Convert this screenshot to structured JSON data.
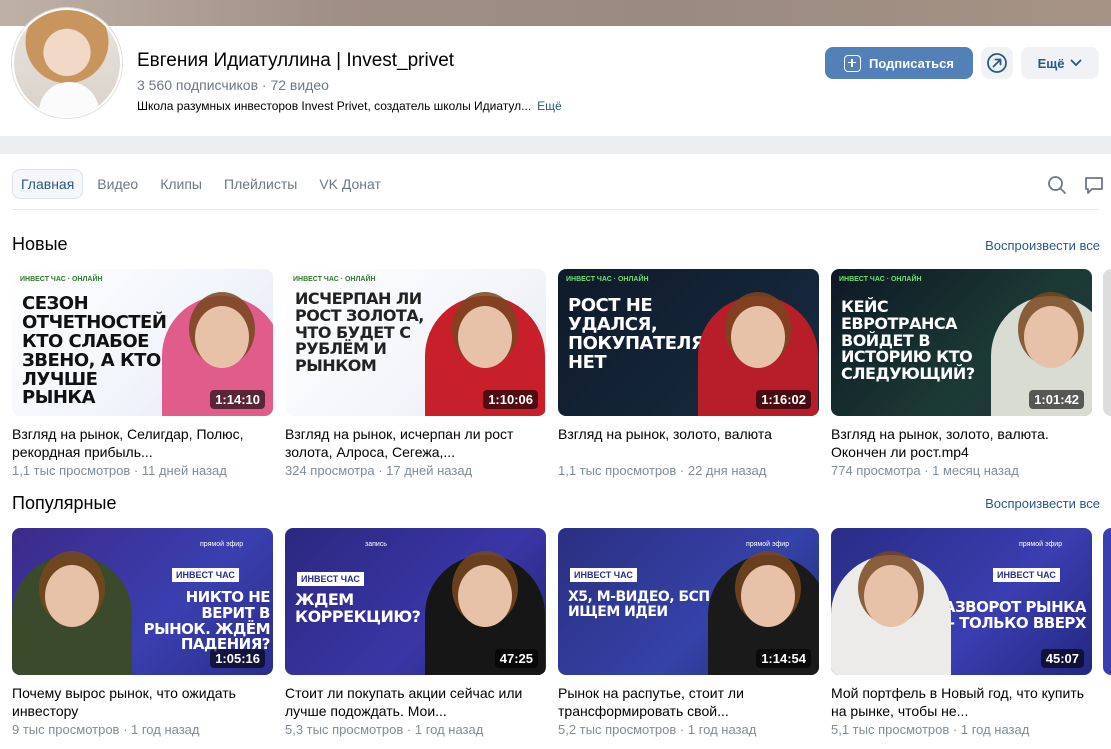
{
  "channel": {
    "name": "Евгения Идиатуллина | Invest_privet",
    "stats": "3 560 подписчиков · 72 видео",
    "description": "Школа разумных инвесторов Invest Privet, создатель школы Идиатул...",
    "description_more": "Ещё",
    "subscribe_label": "Подписаться",
    "more_label": "Ещё"
  },
  "tabs": [
    {
      "label": "Главная",
      "active": true
    },
    {
      "label": "Видео"
    },
    {
      "label": "Клипы"
    },
    {
      "label": "Плейлисты"
    },
    {
      "label": "VK Донат"
    }
  ],
  "sections": {
    "new": {
      "title": "Новые",
      "play_all": "Воспроизвести все"
    },
    "popular": {
      "title": "Популярные",
      "play_all": "Воспроизвести все"
    }
  },
  "new_videos": [
    {
      "title": "Взгляд на рынок, Селигдар, Полюс, рекордная прибыль...",
      "meta": "1,1 тыс просмотров · 11 дней назад",
      "duration": "1:14:10",
      "thumb_text": "СЕЗОН ОТЧЕТНОСТЕЙ КТО СЛАБОЕ ЗВЕНО, А КТО ЛУЧШЕ РЫНКА",
      "badge": "ИНВЕСТ ЧАС · ОНЛАЙН"
    },
    {
      "title": "Взгляд на рынок, исчерпан ли рост золота, Алроса, Сегежа,...",
      "meta": "324 просмотра · 17 дней назад",
      "duration": "1:10:06",
      "thumb_text": "ИСЧЕРПАН ЛИ РОСТ ЗОЛОТА, ЧТО БУДЕТ С РУБЛЁМ И РЫНКОМ",
      "badge": "ИНВЕСТ ЧАС · ОНЛАЙН"
    },
    {
      "title": "Взгляд на рынок, золото, валюта",
      "meta": "1,1 тыс просмотров · 22 дня назад",
      "duration": "1:16:02",
      "thumb_text": "РОСТ НЕ УДАЛСЯ, ПОКУПАТЕЛЯ НЕТ",
      "badge": "ИНВЕСТ ЧАС · ОНЛАЙН"
    },
    {
      "title": "Взгляд на рынок, золото, валюта. Окончен ли рост.mp4",
      "meta": "774 просмотра · 1 месяц назад",
      "duration": "1:01:42",
      "thumb_text": "КЕЙС ЕВРОТРАНСА ВОЙДЕТ В ИСТОРИЮ КТО СЛЕДУЮЩИЙ?",
      "badge": "ИНВЕСТ ЧАС · ОНЛАЙН"
    }
  ],
  "popular_videos": [
    {
      "title": "Почему вырос рынок, что ожидать инвестору",
      "meta": "9 тыс просмотров · 1 год назад",
      "duration": "1:05:16",
      "thumb_text": "НИКТО НЕ ВЕРИТ В РЫНОК. ЖДЁМ ПАДЕНИЯ?",
      "badge": "ИНВЕСТ ЧАС",
      "live": "прямой эфир"
    },
    {
      "title": "Стоит ли покупать акции сейчас или лучше подождать. Мои...",
      "meta": "5,3 тыс просмотров · 1 год назад",
      "duration": "47:25",
      "thumb_text": "ЖДЕМ КОРРЕКЦИЮ?",
      "badge": "ИНВЕСТ ЧАС",
      "live": "запись"
    },
    {
      "title": "Рынок на распутье, стоит ли трансформировать свой...",
      "meta": "5,2 тыс просмотров · 1 год назад",
      "duration": "1:14:54",
      "thumb_text": "X5, М-ВИДЕО, БСП - ИЩЕМ ИДЕИ",
      "badge": "ИНВЕСТ ЧАС",
      "live": "прямой эфир"
    },
    {
      "title": "Мой портфель в Новый год, что купить на рынке, чтобы не...",
      "meta": "5,1 тыс просмотров · 1 год назад",
      "duration": "45:07",
      "thumb_text": "РАЗВОРОТ РЫНКА - ТОЛЬКО ВВЕРХ",
      "badge": "ИНВЕСТ ЧАС",
      "live": "прямой эфир"
    }
  ],
  "icons": {
    "subscribe": "plus-square-icon",
    "share": "share-arrow-icon",
    "more": "chevron-down-icon",
    "search": "search-icon",
    "comments": "comment-icon"
  },
  "colors": {
    "accent": "#5181b8",
    "link": "#2a5885",
    "muted": "#818c99"
  }
}
